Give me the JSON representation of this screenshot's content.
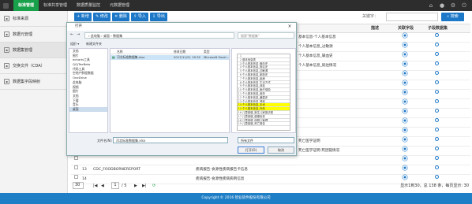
{
  "topnav": {
    "tabs": [
      "标准管理",
      "标准共享管理",
      "数据质量监控",
      "元数据管理"
    ]
  },
  "sidebar": {
    "items": [
      "标准来源",
      "数据元管理",
      "数据集管理",
      "交换文件（CDA）",
      "数据集字段映射"
    ]
  },
  "toolbar": {
    "buttons": [
      "新增",
      "修改",
      "删除",
      "导入",
      "导出"
    ],
    "keyword_label": "关键字：",
    "keyword_value": "",
    "search_label": "搜索"
  },
  "grid": {
    "headers": [
      "描述",
      "关联字段",
      "子段数据集"
    ],
    "rows": [
      {
        "n": "",
        "code": "",
        "name": "",
        "desc": "基本信息-个人基本信息"
      },
      {
        "n": "",
        "code": "",
        "name": "",
        "desc": "个人基本信息_过敏源"
      },
      {
        "n": "",
        "code": "",
        "name": "",
        "desc": "个人基本信息_输血史"
      },
      {
        "n": "",
        "code": "",
        "name": "",
        "desc": "个人基本信息_既往情况"
      },
      {
        "n": "",
        "code": "",
        "name": "",
        "desc": ""
      },
      {
        "n": "",
        "code": "",
        "name": "",
        "desc": ""
      },
      {
        "n": "",
        "code": "",
        "name": "",
        "desc": ""
      },
      {
        "n": "",
        "code": "",
        "name": "",
        "desc": ""
      },
      {
        "n": "",
        "code": "",
        "name": "",
        "desc": ""
      },
      {
        "n": "",
        "code": "",
        "name": "",
        "desc": ""
      },
      {
        "n": "",
        "code": "",
        "name": "",
        "desc": ""
      },
      {
        "n": "",
        "code": "",
        "name": "",
        "desc": "死亡医学证明"
      },
      {
        "n": "",
        "code": "",
        "name": "",
        "desc": "死亡医学证明-死因链情况"
      },
      {
        "n": "",
        "code": "",
        "name": "",
        "desc": ""
      },
      {
        "n": "13",
        "code": "CDC_FOODBORNEREPORT",
        "name": "疾病报告-食源性疾病报告卡信息",
        "desc": ""
      },
      {
        "n": "14",
        "code": "",
        "name": "疾病报告-食源性疾病病例信息",
        "desc": ""
      }
    ]
  },
  "pager": {
    "page_size": "30",
    "page": "1",
    "total_pages": "/ 5",
    "summary": "显示1到30，总 138 条，每页显示: 30"
  },
  "footer": {
    "text": "Copyright © 2016 智业软件股份有限公司"
  },
  "dialog": {
    "title": "打开",
    "path": "› 此电脑 › 桌面 › 数据集",
    "search_placeholder": "搜索\"数据集\"",
    "organize": "组织 ▾",
    "new_folder": "新建文件夹",
    "tree": [
      "文档",
      "图片",
      "echarts工具",
      "QQ/TeeBeto",
      "代码工具",
      "空地产鲜程数据",
      "OneDrive",
      "此电脑",
      "视频",
      "图片",
      "文档",
      "下载",
      "音乐",
      "桌面"
    ],
    "file_headers": [
      "名称",
      "修改日期",
      "类型"
    ],
    "file": {
      "name": "河北标准数据集.xlsx",
      "date": "2017/11/21 19:32",
      "type": "Microsoft Excel..."
    },
    "preview_rows": [
      "",
      "基本信息表",
      "个人基本信息_输血史",
      "个人基本信息_既往史",
      "个人基本信息_过敏源",
      "个人基本信息_家族史",
      "个人基本信息_疾病",
      "个人基本信息_生活方式",
      "个人基本信息_体检",
      "个人基本信息_医疗保险",
      "个人基本信息_用药",
      "个人基本信息_暴露史",
      "个人基本信息_残疾",
      "个人基本信息_手术",
      "个人基本信息_外伤",
      "儿童保健_新生儿家庭访视",
      "儿童保健_健康检查",
      "儿童保健_体弱儿管理",
      "儿童保健_死亡报告"
    ],
    "filename_label": "文件名(N):",
    "filename": "河北标准数据集.xlsx",
    "filetype": "所有文件",
    "open_label": "打开(O)",
    "cancel_label": "取消"
  }
}
